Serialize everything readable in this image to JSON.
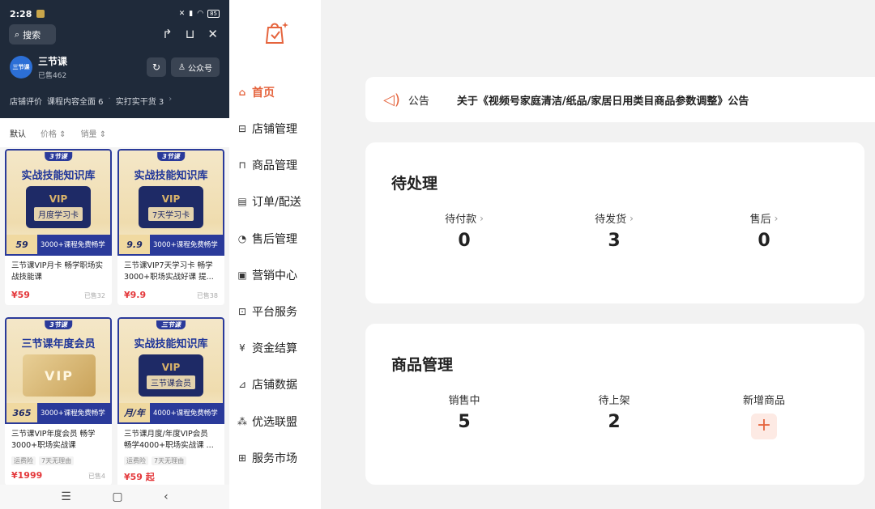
{
  "phone": {
    "status": {
      "time": "2:28",
      "battery": "85"
    },
    "search_label": "搜索",
    "shop": {
      "logo_text": "三节课",
      "name": "三节课",
      "sold": "已售462",
      "follow_label": "公众号"
    },
    "rating": {
      "label": "店铺评价",
      "item1": "课程内容全面 6",
      "item2": "实打实干货 3"
    },
    "sort": [
      "默认",
      "价格",
      "销量"
    ],
    "products": [
      {
        "brand": "3节课",
        "title": "实战技能知识库",
        "box_label": "月度学习卡",
        "vip": "VIP",
        "price_tag": "59",
        "promo": "3000+课程免费畅学",
        "name": "三节课VIP月卡 畅学职场实战技能课",
        "price": "¥59",
        "sold": "已售32"
      },
      {
        "brand": "3节课",
        "title": "实战技能知识库",
        "box_label": "7天学习卡",
        "vip": "VIP",
        "price_tag": "9.9",
        "promo": "3000+课程免费畅学",
        "name": "三节课VIP7天学习卡 畅学3000+职场实战好课 提...",
        "price": "¥9.9",
        "sold": "已售38"
      },
      {
        "brand": "3节课",
        "title": "三节课年度会员",
        "vip": "VIP",
        "price_tag": "365",
        "promo": "3000+课程免费畅学",
        "name": "三节课VIP年度会员 畅学3000+职场实战课",
        "tags": [
          "运费险",
          "7天无理由"
        ],
        "price": "¥1999",
        "sold": "已售4"
      },
      {
        "brand": "三节课",
        "title": "实战技能知识库",
        "box_label": "三节课会员",
        "vip": "VIP",
        "price_tag": "月/年",
        "promo": "4000+课程免费畅学",
        "name": "三节课月度/年度VIP会员 畅学4000+职场实战课 ...",
        "tags": [
          "运费险",
          "7天无理由"
        ],
        "price": "¥59 起",
        "sold": ""
      }
    ]
  },
  "menu": {
    "items": [
      {
        "label": "首页",
        "icon": "home-icon",
        "active": true
      },
      {
        "label": "店铺管理",
        "icon": "store-icon"
      },
      {
        "label": "商品管理",
        "icon": "bag-icon"
      },
      {
        "label": "订单/配送",
        "icon": "order-icon"
      },
      {
        "label": "售后管理",
        "icon": "headset-icon"
      },
      {
        "label": "营销中心",
        "icon": "ticket-icon"
      },
      {
        "label": "平台服务",
        "icon": "briefcase-icon"
      },
      {
        "label": "资金结算",
        "icon": "coin-icon"
      },
      {
        "label": "店铺数据",
        "icon": "chart-icon"
      },
      {
        "label": "优选联盟",
        "icon": "network-icon"
      },
      {
        "label": "服务市场",
        "icon": "grid-icon"
      }
    ]
  },
  "notice": {
    "label": "公告",
    "text": "关于《视频号家庭清洁/纸品/家居日用类目商品参数调整》公告"
  },
  "pending": {
    "title": "待处理",
    "stats": [
      {
        "label": "待付款",
        "value": "0"
      },
      {
        "label": "待发货",
        "value": "3"
      },
      {
        "label": "售后",
        "value": "0"
      }
    ]
  },
  "goods": {
    "title": "商品管理",
    "stats": [
      {
        "label": "销售中",
        "value": "5"
      },
      {
        "label": "待上架",
        "value": "2"
      },
      {
        "label": "新增商品",
        "value": "+"
      }
    ]
  },
  "colors": {
    "accent": "#e5643d",
    "price": "#e4393c",
    "phone_header": "#1f2a3a"
  }
}
